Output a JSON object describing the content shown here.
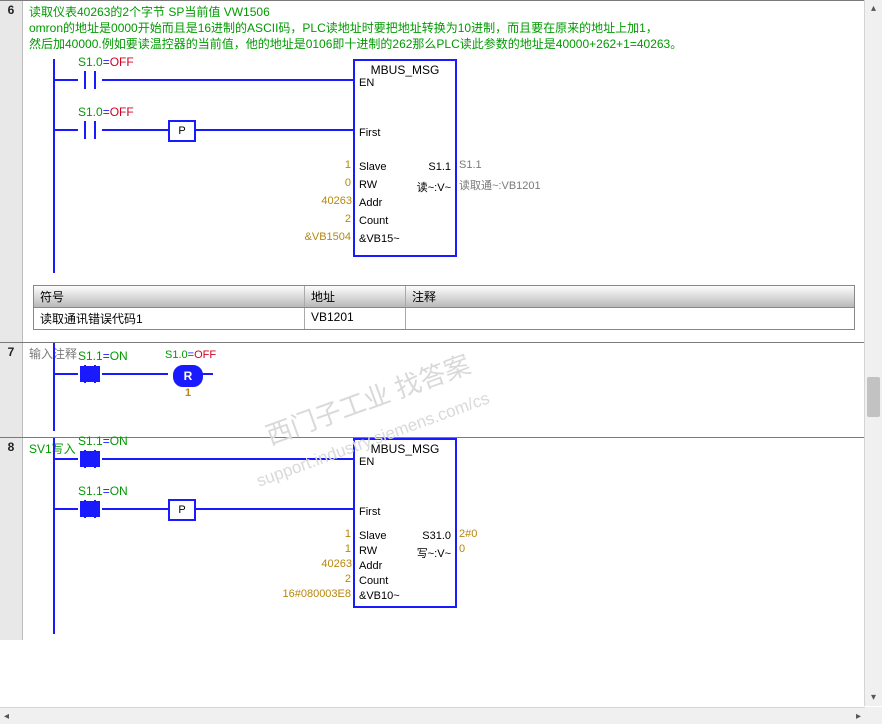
{
  "watermarks": {
    "line1": "西门子工业    找答案",
    "line2": "support.industry.siemens.com/cs"
  },
  "networks": [
    {
      "num": "6",
      "comment": "读取仪表40263的2个字节 SP当前值 VW1506\nomron的地址是0000开始而且是16进制的ASCII码，PLC读地址时要把地址转换为10进制，而且要在原来的地址上加1，\n然后加40000.例如要读温控器的当前值，他的地址是0106即十进制的262那么PLC读此参数的地址是40000+262+1=40263。",
      "contacts": [
        {
          "addr": "S1.0",
          "op": "=",
          "state": "OFF"
        },
        {
          "addr": "S1.0",
          "op": "=",
          "state": "OFF"
        }
      ],
      "edge": "P",
      "block": {
        "title": "MBUS_MSG",
        "left_pins": [
          "EN",
          "",
          "First",
          "",
          "Slave",
          "RW",
          "Addr",
          "Count",
          "&VB15~"
        ],
        "right_pins": [
          "",
          "",
          "",
          "",
          "S1.1",
          "读~:V~",
          "",
          "",
          ""
        ],
        "in_labels": [
          "",
          "",
          "",
          "",
          "1",
          "0",
          "40263",
          "2",
          "&VB1504"
        ],
        "out_labels": [
          "",
          "",
          "",
          "",
          "S1.1",
          "读取通~:VB1201",
          "",
          "",
          ""
        ]
      },
      "symtable": {
        "headers": [
          "符号",
          "地址",
          "注释"
        ],
        "rows": [
          [
            "读取通讯错误代码1",
            "VB1201",
            ""
          ]
        ]
      }
    },
    {
      "num": "7",
      "comment": "输入注释",
      "comment_grey": true,
      "contacts": [
        {
          "addr": "S1.1",
          "op": "=",
          "state": "ON"
        }
      ],
      "coil": {
        "addr": "S1.0",
        "op": "=",
        "state": "OFF",
        "type": "R",
        "sub": "1"
      }
    },
    {
      "num": "8",
      "comment": "SV1写入",
      "contacts": [
        {
          "addr": "S1.1",
          "op": "=",
          "state": "ON"
        },
        {
          "addr": "S1.1",
          "op": "=",
          "state": "ON"
        }
      ],
      "edge": "P",
      "block": {
        "title": "MBUS_MSG",
        "left_pins": [
          "EN",
          "",
          "First",
          "",
          "Slave",
          "RW",
          "Addr",
          "Count",
          "&VB10~"
        ],
        "right_pins": [
          "",
          "",
          "",
          "",
          "S31.0",
          "写~:V~",
          "",
          "",
          ""
        ],
        "in_labels": [
          "",
          "",
          "",
          "",
          "1",
          "1",
          "40263",
          "2",
          "16#080003E8"
        ],
        "out_labels": [
          "",
          "",
          "",
          "",
          "2#0",
          "0",
          "",
          "",
          ""
        ]
      }
    }
  ]
}
